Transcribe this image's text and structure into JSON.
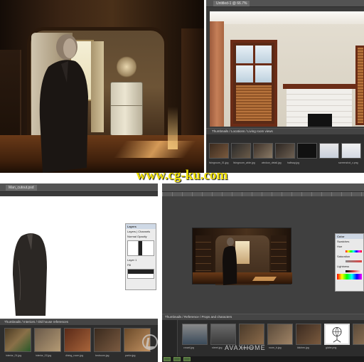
{
  "watermark": {
    "site": "www.cg-ku.com",
    "secondary": "AVAXHOME"
  },
  "panel2": {
    "tab_label": "Untitled-1 @ 66.7%",
    "filmstrip_title": "Thumbnails / Locations / Living room views",
    "thumb_labels": [
      "livingroom_01.jpg",
      "livingroom_wide.jpg",
      "window_detail.jpg",
      "hallway.jpg",
      "screenshot_a.png",
      "screenshot_b.png",
      "screenshot_c.png"
    ]
  },
  "panel3": {
    "tab_label": "Man_cutout.psd",
    "filmstrip_title": "Thumbnails / Interiors / Old house references",
    "thumb_labels": [
      "interior_01.jpg",
      "interior_02.jpg",
      "dining_room.jpg",
      "bedroom.jpg",
      "parlor.jpg"
    ],
    "dialog": {
      "title": "Layers",
      "tab1": "Layers",
      "tab2": "Channels",
      "blend": "Normal",
      "opacity": "Opacity",
      "layer": "Layer 1",
      "fill": "Fill"
    }
  },
  "panel4": {
    "filmstrip_title": "Thumbnails / Reference / Props and characters",
    "thumb_labels": [
      "crowd.jpg",
      "street.jpg",
      "room_a.jpg",
      "room_b.jpg",
      "kitchen.jpg",
      "globe.png",
      "chair.jpg"
    ],
    "color_panel": {
      "title": "Color",
      "tab": "Swatches",
      "labels": [
        "Hue",
        "Saturation",
        "Lightness"
      ]
    }
  },
  "colors": {
    "accent_yellow": "#f0e000",
    "ps_dark": "#3b3b3b",
    "ps_bar": "#535353"
  },
  "icons": [
    "man-silhouette-icon",
    "globe-icon",
    "chair-icon"
  ]
}
